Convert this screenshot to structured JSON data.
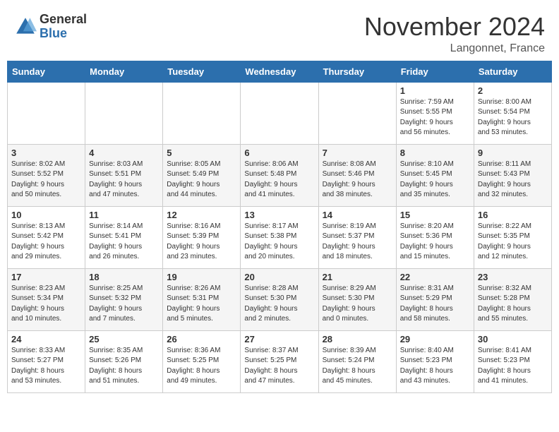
{
  "header": {
    "logo_general": "General",
    "logo_blue": "Blue",
    "month": "November 2024",
    "location": "Langonnet, France"
  },
  "weekdays": [
    "Sunday",
    "Monday",
    "Tuesday",
    "Wednesday",
    "Thursday",
    "Friday",
    "Saturday"
  ],
  "weeks": [
    [
      {
        "day": "",
        "detail": ""
      },
      {
        "day": "",
        "detail": ""
      },
      {
        "day": "",
        "detail": ""
      },
      {
        "day": "",
        "detail": ""
      },
      {
        "day": "",
        "detail": ""
      },
      {
        "day": "1",
        "detail": "Sunrise: 7:59 AM\nSunset: 5:55 PM\nDaylight: 9 hours\nand 56 minutes."
      },
      {
        "day": "2",
        "detail": "Sunrise: 8:00 AM\nSunset: 5:54 PM\nDaylight: 9 hours\nand 53 minutes."
      }
    ],
    [
      {
        "day": "3",
        "detail": "Sunrise: 8:02 AM\nSunset: 5:52 PM\nDaylight: 9 hours\nand 50 minutes."
      },
      {
        "day": "4",
        "detail": "Sunrise: 8:03 AM\nSunset: 5:51 PM\nDaylight: 9 hours\nand 47 minutes."
      },
      {
        "day": "5",
        "detail": "Sunrise: 8:05 AM\nSunset: 5:49 PM\nDaylight: 9 hours\nand 44 minutes."
      },
      {
        "day": "6",
        "detail": "Sunrise: 8:06 AM\nSunset: 5:48 PM\nDaylight: 9 hours\nand 41 minutes."
      },
      {
        "day": "7",
        "detail": "Sunrise: 8:08 AM\nSunset: 5:46 PM\nDaylight: 9 hours\nand 38 minutes."
      },
      {
        "day": "8",
        "detail": "Sunrise: 8:10 AM\nSunset: 5:45 PM\nDaylight: 9 hours\nand 35 minutes."
      },
      {
        "day": "9",
        "detail": "Sunrise: 8:11 AM\nSunset: 5:43 PM\nDaylight: 9 hours\nand 32 minutes."
      }
    ],
    [
      {
        "day": "10",
        "detail": "Sunrise: 8:13 AM\nSunset: 5:42 PM\nDaylight: 9 hours\nand 29 minutes."
      },
      {
        "day": "11",
        "detail": "Sunrise: 8:14 AM\nSunset: 5:41 PM\nDaylight: 9 hours\nand 26 minutes."
      },
      {
        "day": "12",
        "detail": "Sunrise: 8:16 AM\nSunset: 5:39 PM\nDaylight: 9 hours\nand 23 minutes."
      },
      {
        "day": "13",
        "detail": "Sunrise: 8:17 AM\nSunset: 5:38 PM\nDaylight: 9 hours\nand 20 minutes."
      },
      {
        "day": "14",
        "detail": "Sunrise: 8:19 AM\nSunset: 5:37 PM\nDaylight: 9 hours\nand 18 minutes."
      },
      {
        "day": "15",
        "detail": "Sunrise: 8:20 AM\nSunset: 5:36 PM\nDaylight: 9 hours\nand 15 minutes."
      },
      {
        "day": "16",
        "detail": "Sunrise: 8:22 AM\nSunset: 5:35 PM\nDaylight: 9 hours\nand 12 minutes."
      }
    ],
    [
      {
        "day": "17",
        "detail": "Sunrise: 8:23 AM\nSunset: 5:34 PM\nDaylight: 9 hours\nand 10 minutes."
      },
      {
        "day": "18",
        "detail": "Sunrise: 8:25 AM\nSunset: 5:32 PM\nDaylight: 9 hours\nand 7 minutes."
      },
      {
        "day": "19",
        "detail": "Sunrise: 8:26 AM\nSunset: 5:31 PM\nDaylight: 9 hours\nand 5 minutes."
      },
      {
        "day": "20",
        "detail": "Sunrise: 8:28 AM\nSunset: 5:30 PM\nDaylight: 9 hours\nand 2 minutes."
      },
      {
        "day": "21",
        "detail": "Sunrise: 8:29 AM\nSunset: 5:30 PM\nDaylight: 9 hours\nand 0 minutes."
      },
      {
        "day": "22",
        "detail": "Sunrise: 8:31 AM\nSunset: 5:29 PM\nDaylight: 8 hours\nand 58 minutes."
      },
      {
        "day": "23",
        "detail": "Sunrise: 8:32 AM\nSunset: 5:28 PM\nDaylight: 8 hours\nand 55 minutes."
      }
    ],
    [
      {
        "day": "24",
        "detail": "Sunrise: 8:33 AM\nSunset: 5:27 PM\nDaylight: 8 hours\nand 53 minutes."
      },
      {
        "day": "25",
        "detail": "Sunrise: 8:35 AM\nSunset: 5:26 PM\nDaylight: 8 hours\nand 51 minutes."
      },
      {
        "day": "26",
        "detail": "Sunrise: 8:36 AM\nSunset: 5:25 PM\nDaylight: 8 hours\nand 49 minutes."
      },
      {
        "day": "27",
        "detail": "Sunrise: 8:37 AM\nSunset: 5:25 PM\nDaylight: 8 hours\nand 47 minutes."
      },
      {
        "day": "28",
        "detail": "Sunrise: 8:39 AM\nSunset: 5:24 PM\nDaylight: 8 hours\nand 45 minutes."
      },
      {
        "day": "29",
        "detail": "Sunrise: 8:40 AM\nSunset: 5:23 PM\nDaylight: 8 hours\nand 43 minutes."
      },
      {
        "day": "30",
        "detail": "Sunrise: 8:41 AM\nSunset: 5:23 PM\nDaylight: 8 hours\nand 41 minutes."
      }
    ]
  ]
}
